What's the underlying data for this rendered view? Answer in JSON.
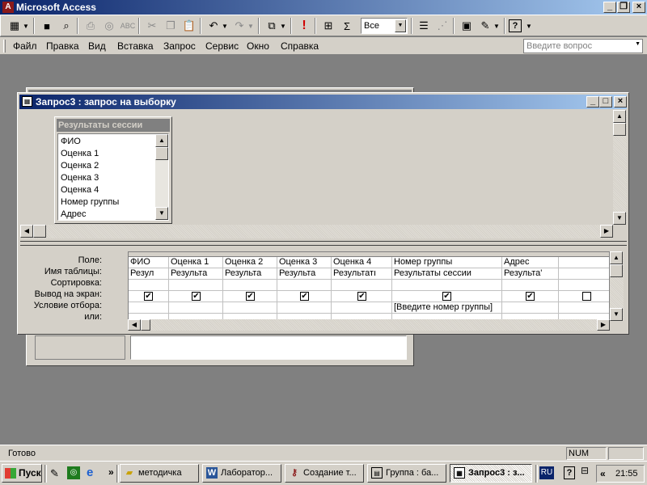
{
  "app": {
    "title": "Microsoft Access"
  },
  "toolbar": {
    "view_value": "Все",
    "icons": [
      "view-icon",
      "save-icon",
      "search-icon",
      "print-icon",
      "print-preview-icon",
      "spelling-icon",
      "cut-icon",
      "copy-icon",
      "paste-icon",
      "undo-icon",
      "redo-icon",
      "query-type-icon",
      "run-icon",
      "show-table-icon",
      "totals-icon",
      "properties-icon",
      "build-icon",
      "database-window-icon",
      "new-object-icon",
      "help-icon"
    ]
  },
  "menu": {
    "items": [
      "Файл",
      "Правка",
      "Вид",
      "Вставка",
      "Запрос",
      "Сервис",
      "Окно",
      "Справка"
    ],
    "help_placeholder": "Введите вопрос"
  },
  "query_window": {
    "title": "Запрос3 : запрос на выборку"
  },
  "table_box": {
    "title": "Результаты сессии",
    "fields": [
      "ФИО",
      "Оценка 1",
      "Оценка 2",
      "Оценка 3",
      "Оценка 4",
      "Номер группы",
      "Адрес"
    ]
  },
  "grid": {
    "row_labels": [
      "Поле:",
      "Имя таблицы:",
      "Сортировка:",
      "Вывод на экран:",
      "Условие отбора:",
      "или:"
    ],
    "columns": [
      {
        "field": "ФИО",
        "table": "Резул",
        "show": true,
        "criteria": ""
      },
      {
        "field": "Оценка 1",
        "table": "Результа",
        "show": true,
        "criteria": ""
      },
      {
        "field": "Оценка 2",
        "table": "Результа",
        "show": true,
        "criteria": ""
      },
      {
        "field": "Оценка 3",
        "table": "Результа",
        "show": true,
        "criteria": ""
      },
      {
        "field": "Оценка 4",
        "table": "Результатı",
        "show": true,
        "criteria": ""
      },
      {
        "field": "Номер группы",
        "table": "Результаты сессии",
        "show": true,
        "criteria": "[Введите номер группы]"
      },
      {
        "field": "Адрес",
        "table": "Результа'",
        "show": true,
        "criteria": ""
      },
      {
        "field": "",
        "table": "",
        "show": false,
        "criteria": ""
      }
    ]
  },
  "status": {
    "text": "Готово",
    "indicator": "NUM"
  },
  "taskbar": {
    "start": "Пуск",
    "tasks": [
      "методичка",
      "Лаборатор...",
      "Создание т...",
      "Группа : ба...",
      "Запрос3 : з..."
    ],
    "lang": "RU",
    "clock": "21:55",
    "chevron": "»",
    "tray_chevron": "«"
  },
  "colors": {
    "title_active": "#0a246a",
    "title_inactive": "#808080",
    "face": "#d4d0c8",
    "workspace": "#808080",
    "taskbar": "#d4d0c8"
  }
}
